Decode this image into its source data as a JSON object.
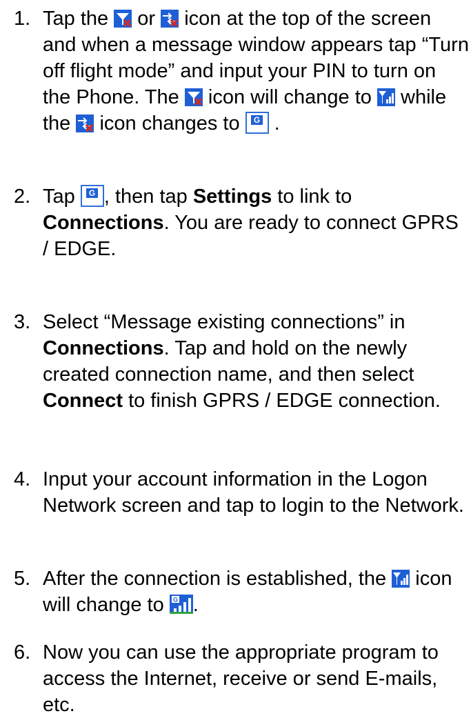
{
  "steps": [
    {
      "num": "1.",
      "parts": {
        "a": "Tap the",
        "b": "or",
        "c": "icon at the top of the screen and when a message window appears tap “Turn off flight mode” and input your PIN to turn on the Phone. The",
        "d": "icon will change to",
        "e": "while the",
        "f": "icon changes to",
        "g": "."
      }
    },
    {
      "num": "2.",
      "parts": {
        "a": "Tap",
        "b": ", then tap",
        "c": "Settings",
        "d": "to link to",
        "e": "Connections",
        "f": ". You are ready to connect GPRS / EDGE."
      }
    },
    {
      "num": "3.",
      "parts": {
        "a": "Select “Message existing connections” in",
        "b": "Connections",
        "c": ". Tap and hold on the newly created connection name, and then select",
        "d": "Connect",
        "e": "to finish GPRS / EDGE connection."
      }
    },
    {
      "num": "4.",
      "parts": {
        "a": "Input your account information in the Logon Network screen and tap to login to the Network."
      }
    },
    {
      "num": "5.",
      "parts": {
        "a": "After the connection is established, the",
        "b": "icon will change to",
        "c": "."
      }
    },
    {
      "num": "6.",
      "parts": {
        "a": "Now you can use the appropriate program to access the Internet, receive or send E-mails, etc."
      }
    }
  ],
  "icons": {
    "phone_off": "phone-off-icon",
    "data_off": "data-off-icon",
    "signal": "signal-icon",
    "gprs": "gprs-icon",
    "gprs_signal": "gprs-signal-icon"
  },
  "colors": {
    "icon_blue": "#1f5fd6",
    "icon_red": "#d62a1f",
    "icon_green": "#2ea33a",
    "text": "#000000"
  }
}
